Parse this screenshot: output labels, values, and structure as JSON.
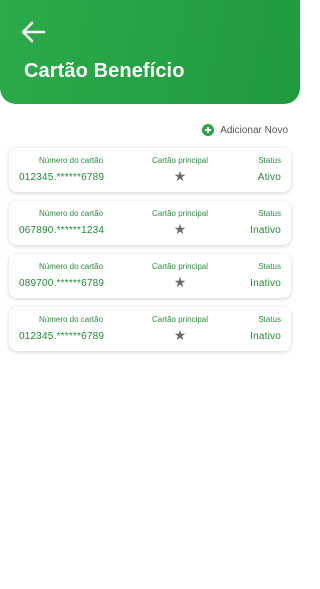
{
  "header": {
    "title": "Cartão Benefício",
    "back_icon": "arrow-left-icon"
  },
  "actions": {
    "add_new_label": "Adicionar Novo",
    "add_new_icon": "plus-circle-icon"
  },
  "cards_meta": {
    "number_label": "Número do cartão",
    "main_label": "Cartão principal",
    "status_label": "Status",
    "main_icon": "star-icon"
  },
  "cards": [
    {
      "number": "012345.******6789",
      "status": "Ativo"
    },
    {
      "number": "067890.******1234",
      "status": "Inativo"
    },
    {
      "number": "089700.******6789",
      "status": "Inativo"
    },
    {
      "number": "012345.******6789",
      "status": "Inativo"
    }
  ],
  "colors": {
    "brand_green": "#28a745",
    "star_gray": "#6b6b6b"
  }
}
